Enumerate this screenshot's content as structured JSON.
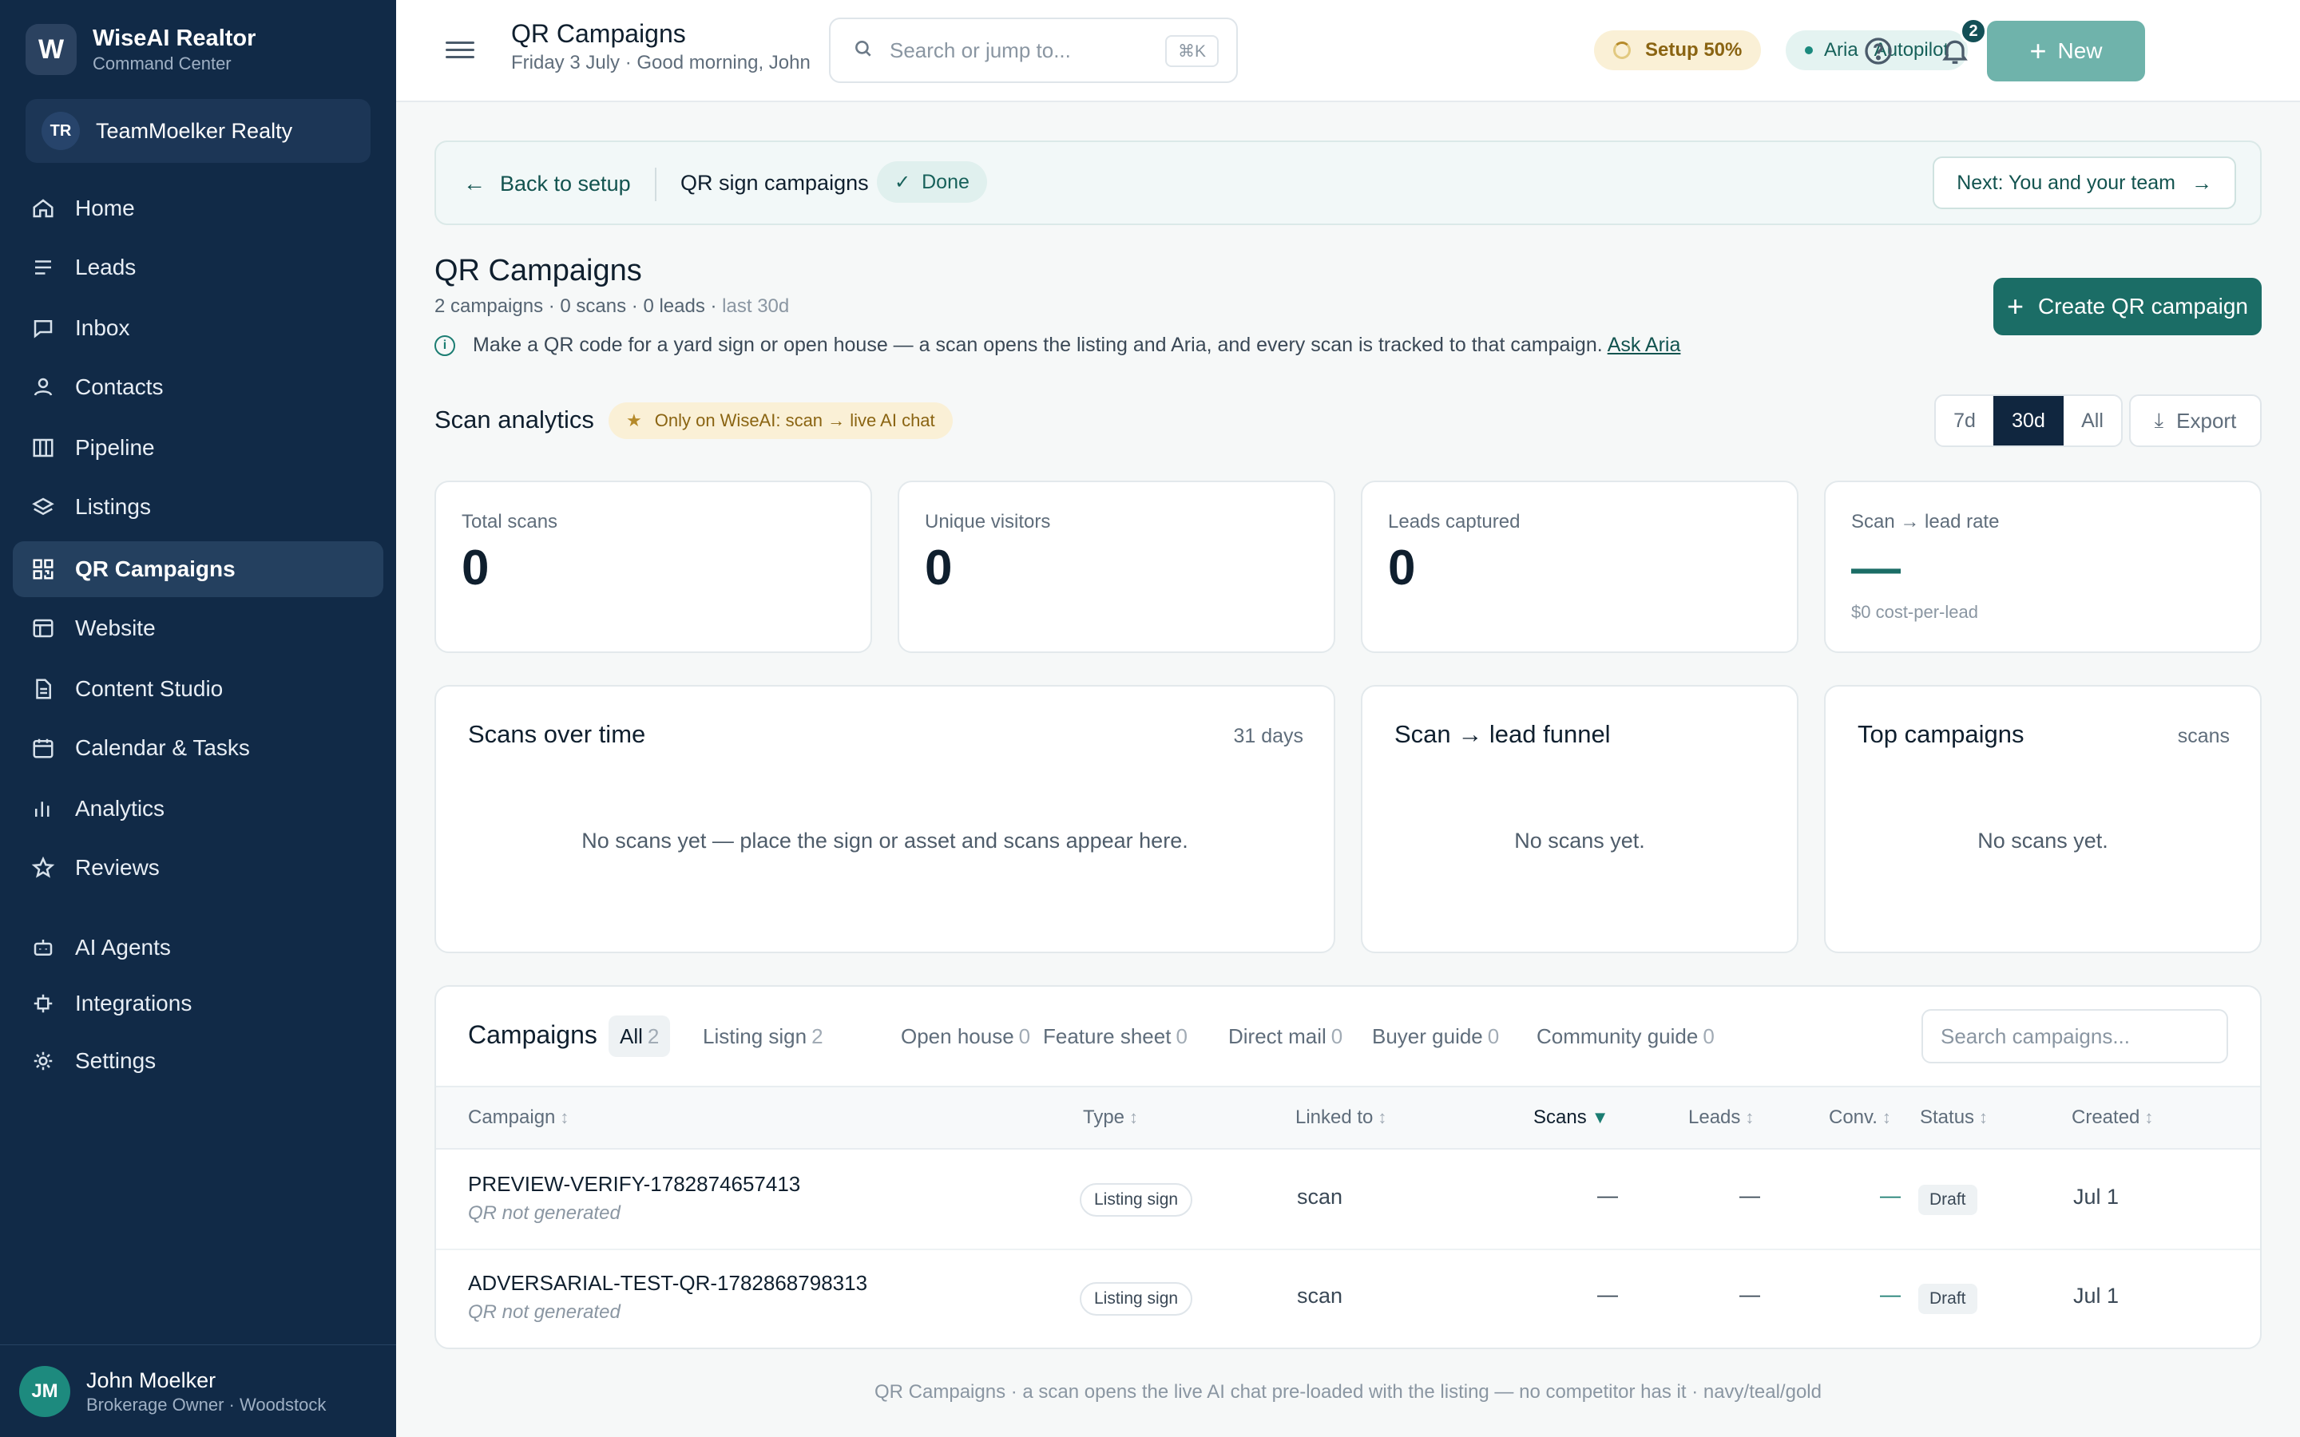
{
  "sidebar": {
    "brand": {
      "logo_letter": "W",
      "title": "WiseAI Realtor",
      "subtitle": "Command Center"
    },
    "workspace": {
      "initials": "TR",
      "name": "TeamMoelker Realty"
    },
    "items": [
      {
        "label": "Home",
        "icon": "home-icon"
      },
      {
        "label": "Leads",
        "icon": "list-icon"
      },
      {
        "label": "Inbox",
        "icon": "chat-icon"
      },
      {
        "label": "Contacts",
        "icon": "person-icon"
      },
      {
        "label": "Pipeline",
        "icon": "columns-icon"
      },
      {
        "label": "Listings",
        "icon": "layers-icon"
      },
      {
        "label": "QR Campaigns",
        "icon": "qr-icon",
        "active": true
      },
      {
        "label": "Website",
        "icon": "browser-icon"
      },
      {
        "label": "Content Studio",
        "icon": "document-icon"
      },
      {
        "label": "Calendar & Tasks",
        "icon": "calendar-icon"
      },
      {
        "label": "Analytics",
        "icon": "bar-chart-icon"
      },
      {
        "label": "Reviews",
        "icon": "star-icon"
      },
      {
        "label": "AI Agents",
        "icon": "robot-icon"
      },
      {
        "label": "Integrations",
        "icon": "plug-icon"
      },
      {
        "label": "Settings",
        "icon": "gear-icon"
      }
    ],
    "user": {
      "initials": "JM",
      "name": "John Moelker",
      "role": "Brokerage Owner · Woodstock"
    }
  },
  "topbar": {
    "title": "QR Campaigns",
    "subtitle": "Friday 3 July · Good morning, John",
    "search_placeholder": "Search or jump to...",
    "search_shortcut": "⌘K",
    "setup_label": "Setup 50%",
    "aria_label": "Aria · Autopilot",
    "notification_count": "2",
    "new_label": "New"
  },
  "banner": {
    "back_label": "Back to setup",
    "step_label": "QR sign campaigns",
    "done_label": "Done",
    "next_label": "Next: You and your team"
  },
  "header": {
    "title": "QR Campaigns",
    "stats": "2 campaigns · 0 scans · 0 leads ·",
    "period": "last 30d",
    "info_text": "Make a QR code for a yard sign or open house — a scan opens the listing and Aria, and every scan is tracked to that campaign.",
    "ask_link": "Ask Aria",
    "create_label": "Create QR campaign"
  },
  "analytics": {
    "title": "Scan analytics",
    "badge": "Only on WiseAI: scan → live AI chat",
    "ranges": [
      "7d",
      "30d",
      "All"
    ],
    "selected_range": "30d",
    "export_label": "Export",
    "kpis": [
      {
        "label": "Total scans",
        "value": "0",
        "foot": ""
      },
      {
        "label": "Unique visitors",
        "value": "0",
        "foot": ""
      },
      {
        "label": "Leads captured",
        "value": "0",
        "foot": ""
      },
      {
        "label": "Scan → lead rate",
        "value": "—",
        "foot": "$0 cost-per-lead"
      }
    ],
    "panels": {
      "scans_over_time": {
        "title": "Scans over time",
        "meta": "31 days",
        "empty": "No scans yet — place the sign or asset and scans appear here."
      },
      "funnel": {
        "title": "Scan → lead funnel",
        "empty": "No scans yet."
      },
      "top": {
        "title": "Top campaigns",
        "meta": "scans",
        "empty": "No scans yet."
      }
    }
  },
  "campaigns": {
    "title": "Campaigns",
    "tabs": [
      {
        "label": "All",
        "count": "2"
      },
      {
        "label": "Listing sign",
        "count": "2"
      },
      {
        "label": "Open house",
        "count": "0"
      },
      {
        "label": "Feature sheet",
        "count": "0"
      },
      {
        "label": "Direct mail",
        "count": "0"
      },
      {
        "label": "Buyer guide",
        "count": "0"
      },
      {
        "label": "Community guide",
        "count": "0"
      }
    ],
    "search_placeholder": "Search campaigns...",
    "columns": [
      "Campaign",
      "Type",
      "Linked to",
      "Scans",
      "Leads",
      "Conv.",
      "Status",
      "Created"
    ],
    "sorted_column": "Scans",
    "rows": [
      {
        "name": "PREVIEW-VERIFY-1782874657413",
        "sub": "QR not generated",
        "type": "Listing sign",
        "linked": "scan",
        "scans": "—",
        "leads": "—",
        "conv": "—",
        "status": "Draft",
        "created": "Jul 1"
      },
      {
        "name": "ADVERSARIAL-TEST-QR-1782868798313",
        "sub": "QR not generated",
        "type": "Listing sign",
        "linked": "scan",
        "scans": "—",
        "leads": "—",
        "conv": "—",
        "status": "Draft",
        "created": "Jul 1"
      }
    ]
  },
  "footer": "QR Campaigns · a scan opens the live AI chat pre-loaded with the listing — no competitor has it · navy/teal/gold",
  "colors": {
    "navy": "#112a47",
    "teal": "#1b6d66",
    "gold": "#b58a2a"
  }
}
